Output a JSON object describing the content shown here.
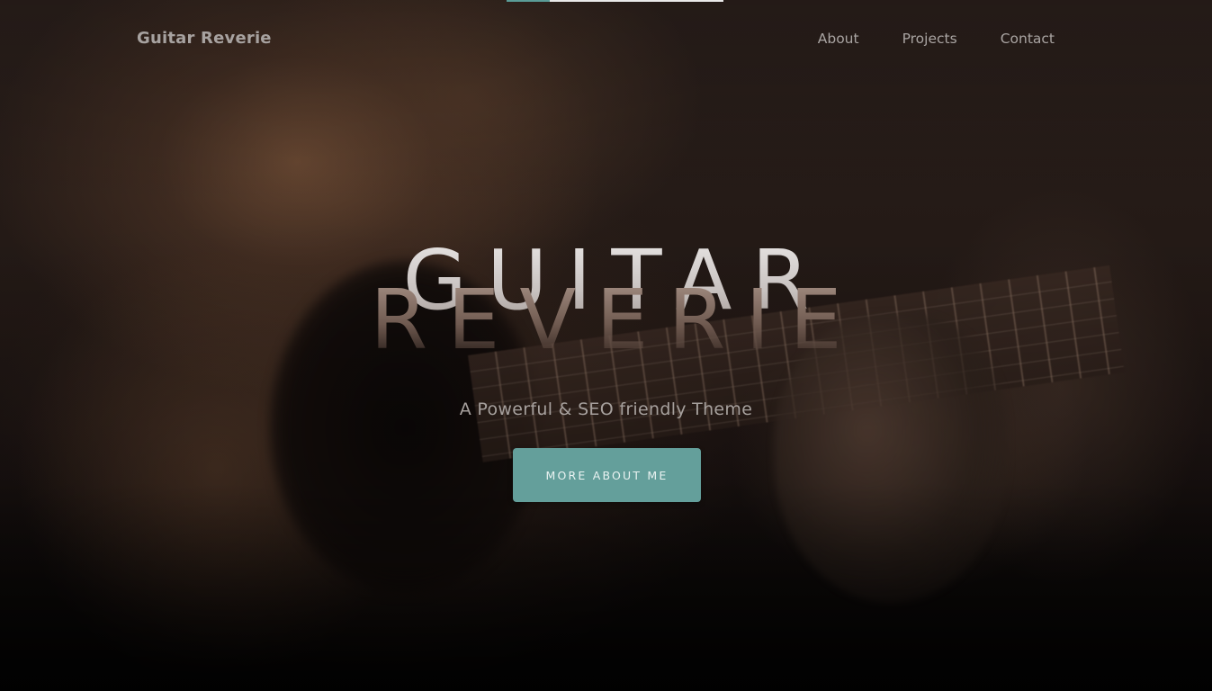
{
  "header": {
    "brand": "Guitar Reverie",
    "nav": [
      "About",
      "Projects",
      "Contact"
    ]
  },
  "hero": {
    "title_line_1": "GUITAR",
    "title_line_2": "REVERIE",
    "subtitle": "A Powerful & SEO friendly Theme",
    "cta_label": "MORE ABOUT ME"
  },
  "colors": {
    "accent": "#649f9b",
    "background": "#1b1311",
    "nav_text": "#a9a4a2"
  },
  "background_image": "blurred close-up of hands playing an acoustic guitar"
}
